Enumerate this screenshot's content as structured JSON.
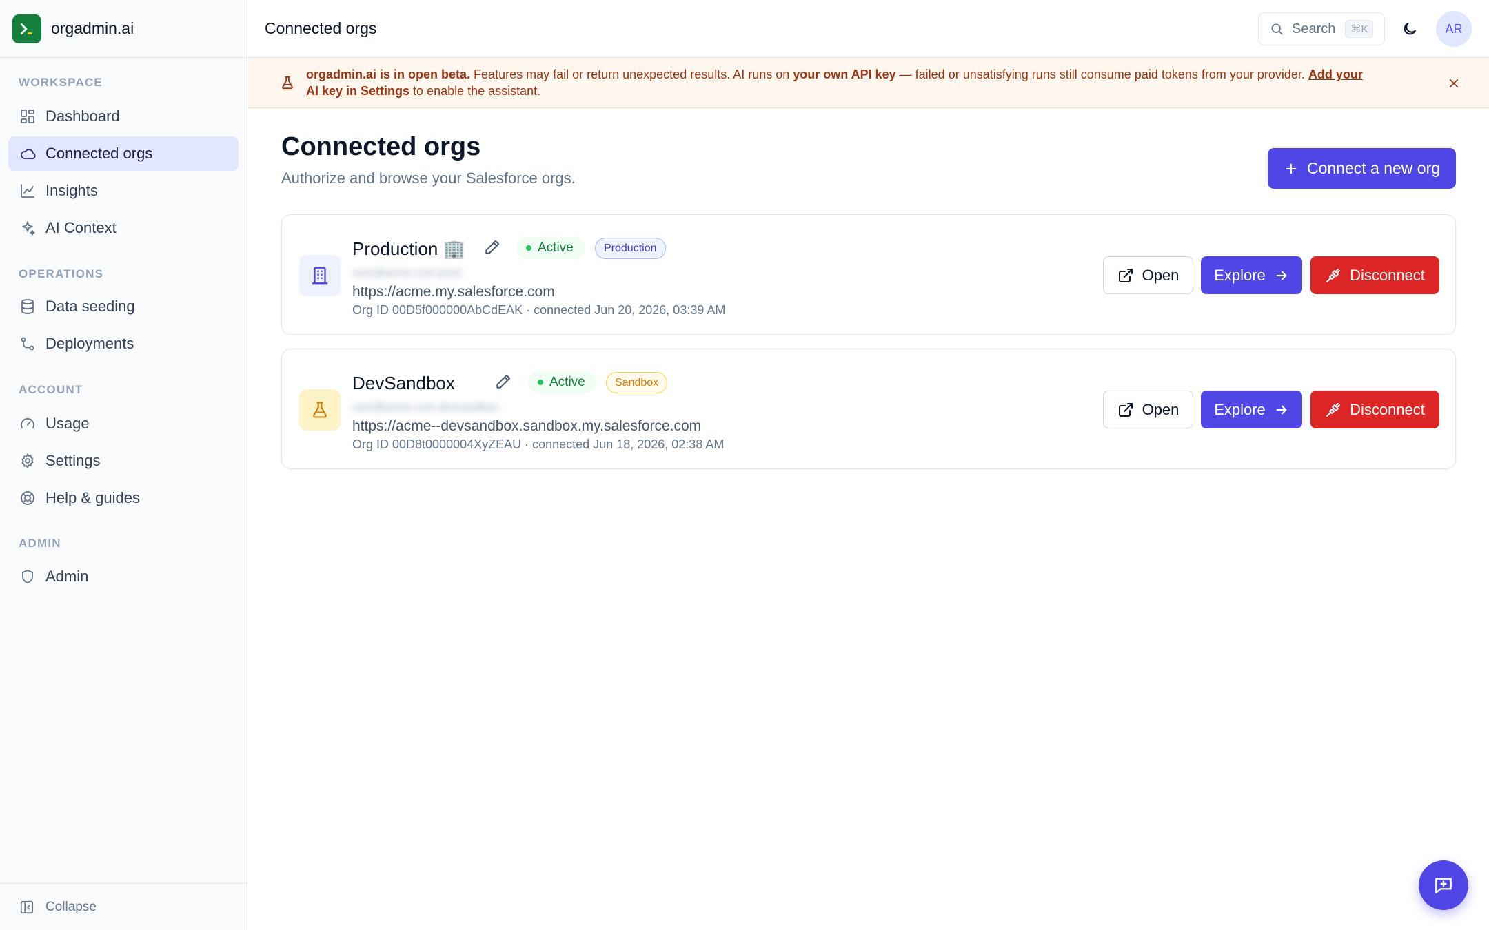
{
  "brand": {
    "name": "orgadmin.ai"
  },
  "sidebar": {
    "sections": [
      {
        "title": "WORKSPACE"
      },
      {
        "title": "OPERATIONS"
      },
      {
        "title": "ACCOUNT"
      },
      {
        "title": "ADMIN"
      }
    ],
    "items": [
      {
        "label": "Dashboard",
        "icon": "dashboard-icon"
      },
      {
        "label": "Connected orgs",
        "icon": "cloud-icon",
        "active": true
      },
      {
        "label": "Insights",
        "icon": "chart-icon"
      },
      {
        "label": "AI Context",
        "icon": "sparkles-icon"
      },
      {
        "label": "Data seeding",
        "icon": "database-icon"
      },
      {
        "label": "Deployments",
        "icon": "git-branch-icon"
      },
      {
        "label": "Usage",
        "icon": "gauge-icon"
      },
      {
        "label": "Settings",
        "icon": "gear-icon"
      },
      {
        "label": "Help & guides",
        "icon": "lifebuoy-icon"
      },
      {
        "label": "Admin",
        "icon": "shield-icon"
      }
    ],
    "collapse_label": "Collapse"
  },
  "header": {
    "title": "Connected orgs",
    "search_label": "Search",
    "search_shortcut": "⌘K",
    "avatar_initials": "AR"
  },
  "banner": {
    "strong_intro": "orgadmin.ai is in open beta.",
    "text_1": " Features may fail or return unexpected results. AI runs on ",
    "strong_key": "your own API key",
    "text_2": " — failed or unsatisfying runs still consume paid tokens from your provider. ",
    "link_part1": "Add your",
    "link_part2": "AI key in Settings",
    "text_3": " to enable the assistant."
  },
  "main": {
    "title": "Connected orgs",
    "subtitle": "Authorize and browse your Salesforce orgs.",
    "connect_label": "Connect a new org"
  },
  "orgs": [
    {
      "name": "Production",
      "emoji": "🏢",
      "status": "Active",
      "type": "Production",
      "email": "user@acme.com.prod",
      "url": "https://acme.my.salesforce.com",
      "meta": "Org ID 00D5f000000AbCdEAK · connected Jun 20, 2026, 03:39 AM"
    },
    {
      "name": "DevSandbox",
      "emoji": "",
      "status": "Active",
      "type": "Sandbox",
      "email": "user@acme.com.devsandbox",
      "url": "https://acme--devsandbox.sandbox.my.salesforce.com",
      "meta": "Org ID 00D8t0000004XyZEAU · connected Jun 18, 2026, 02:38 AM"
    }
  ],
  "actions": {
    "open_label": "Open",
    "explore_label": "Explore",
    "disconnect_label": "Disconnect"
  },
  "colors": {
    "accent": "#4f46e5",
    "danger": "#dc2626",
    "success": "#15803d",
    "brand": "#15803d",
    "banner_bg": "#fff7ed"
  }
}
